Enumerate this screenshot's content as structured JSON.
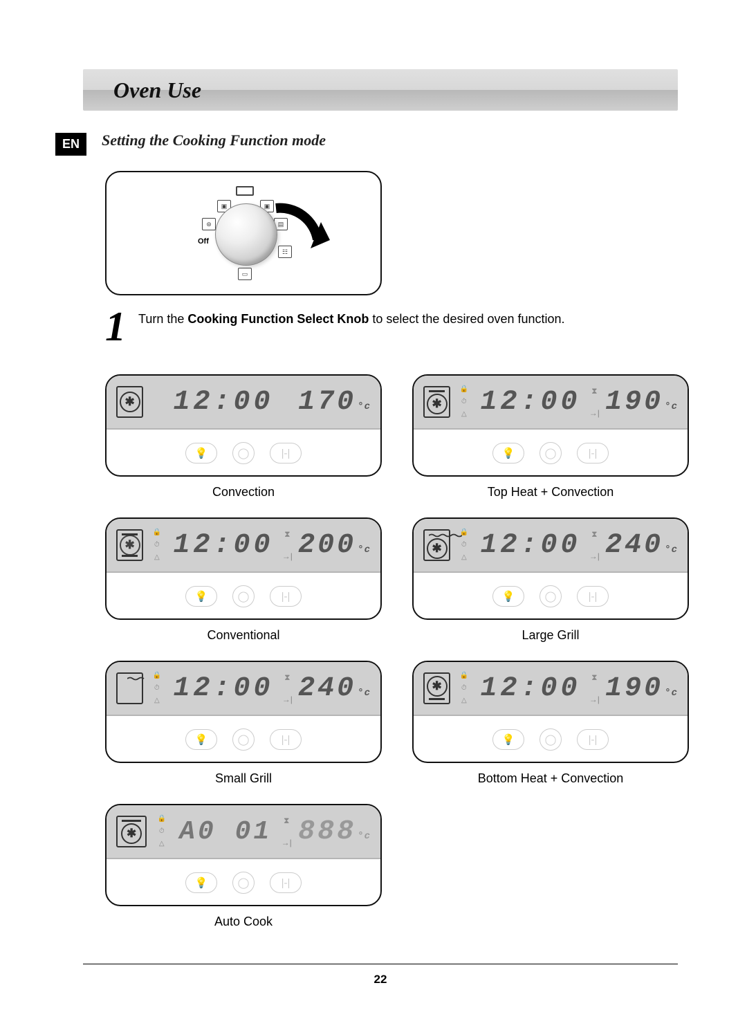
{
  "title": "Oven Use",
  "lang_badge": "EN",
  "subheading": "Setting the Cooking Function mode",
  "knob": {
    "off_label": "Off"
  },
  "step": {
    "number": "1",
    "text_prefix": "Turn the ",
    "text_bold": "Cooking Function Select Knob",
    "text_suffix": " to select the desired oven function."
  },
  "modes": [
    {
      "name": "Convection",
      "time": "12:00",
      "temp": "170",
      "unit": "°c",
      "icon": "fan",
      "simple": true
    },
    {
      "name": "Top Heat + Convection",
      "time": "12:00",
      "temp": "190",
      "unit": "°c",
      "icon": "fan_top",
      "simple": false
    },
    {
      "name": "Conventional",
      "time": "12:00",
      "temp": "200",
      "unit": "°c",
      "icon": "top_bottom",
      "simple": false
    },
    {
      "name": "Large Grill",
      "time": "12:00",
      "temp": "240",
      "unit": "°c",
      "icon": "wavy_large",
      "simple": false
    },
    {
      "name": "Small Grill",
      "time": "12:00",
      "temp": "240",
      "unit": "°c",
      "icon": "wavy_small",
      "simple": false
    },
    {
      "name": "Bottom Heat + Convection",
      "time": "12:00",
      "temp": "190",
      "unit": "°c",
      "icon": "fan_bottom",
      "simple": false
    },
    {
      "name": "Auto Cook",
      "time": "A0 01",
      "temp": "888",
      "unit": "°c",
      "icon": "fan_top",
      "simple": false,
      "auto": true
    }
  ],
  "page_number": "22"
}
